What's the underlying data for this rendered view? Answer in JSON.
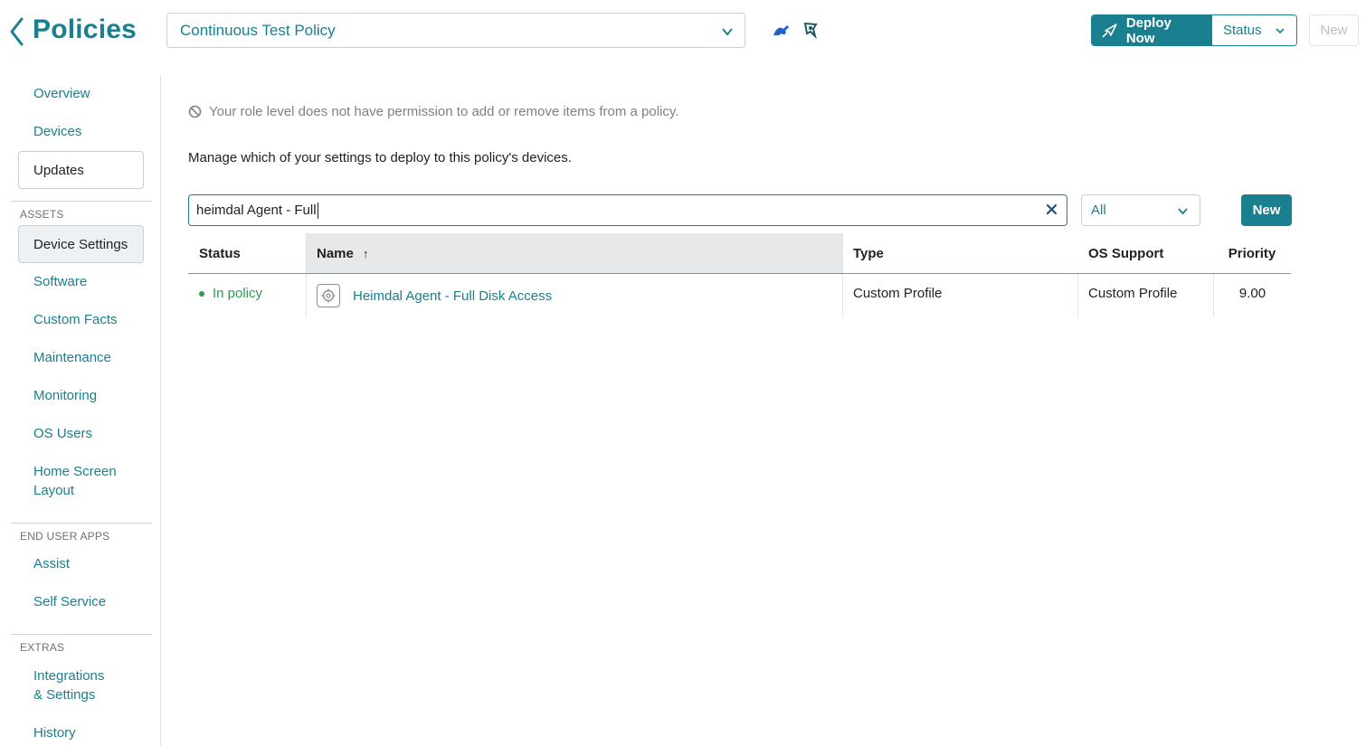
{
  "header": {
    "title": "Policies",
    "policy_select": "Continuous Test Policy",
    "deploy_label": "Deploy Now",
    "status_label": "Status",
    "new_label": "New"
  },
  "sidebar": {
    "items_top": [
      "Overview",
      "Devices",
      "Updates"
    ],
    "section_assets": "ASSETS",
    "assets": [
      "Device Settings",
      "Software",
      "Custom Facts",
      "Maintenance",
      "Monitoring",
      "OS Users",
      "Home Screen",
      "Layout"
    ],
    "section_end_user": "END USER APPS",
    "end_user": [
      "Assist",
      "Self Service"
    ],
    "section_extras": "EXTRAS",
    "extras": [
      "Integrations",
      "& Settings",
      "History"
    ]
  },
  "main": {
    "notice": "Your role level does not have permission to add or remove items from a policy.",
    "manage_text": "Manage which of your settings to deploy to this policy's devices.",
    "search_value": "heimdal Agent - Full",
    "filter_value": "All",
    "new_button": "New"
  },
  "table": {
    "headers": {
      "status": "Status",
      "name": "Name",
      "sort": "↑",
      "type": "Type",
      "os_support": "OS Support",
      "priority": "Priority"
    },
    "rows": [
      {
        "status": "In policy",
        "name": "Heimdal Agent - Full Disk Access",
        "type": "Custom Profile",
        "os_support": "Custom Profile",
        "priority": "9.00"
      }
    ]
  },
  "colors": {
    "accent": "#1a7f8e",
    "status_green": "#2e9a4e"
  },
  "icons": {
    "back": "chevron-left-icon",
    "dropdown": "chevron-down-icon",
    "header_tool_1": "wrench-icon",
    "header_tool_2": "pin-icon",
    "deploy": "rocket-icon",
    "notice": "no-entry-icon",
    "clear": "close-icon",
    "row": "gear-icon"
  }
}
